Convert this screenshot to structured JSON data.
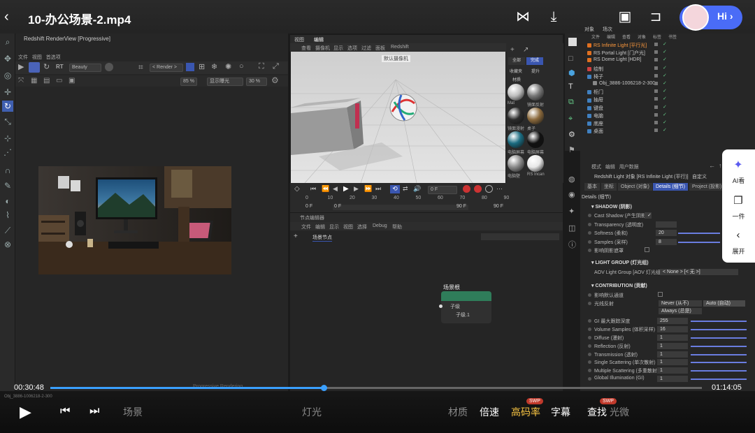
{
  "video": {
    "title": "10-办公场景-2.mp4",
    "time_current": "00:30:48",
    "time_total": "01:14:05",
    "progress": 0.42
  },
  "user": {
    "greeting": "Hi"
  },
  "top_icons": [
    "share-icon",
    "download-icon",
    "screen-capture-icon",
    "exit-fullscreen-icon"
  ],
  "render_view": {
    "title": "Redshift RenderView [Progressive]",
    "menu": [
      "文件",
      "视图",
      "首选项"
    ],
    "aov_select": "Beauty",
    "camera_select": "< Render >",
    "zoom_a": "85 %",
    "zoom_b": "30 %",
    "display_select": "显示曝光"
  },
  "viewport": {
    "tabs": [
      "视图",
      "编辑"
    ],
    "menu": [
      "查看",
      "摄像机",
      "显示",
      "选项",
      "过滤",
      "面板",
      "Redshift"
    ],
    "camera_label": "默认摄像机"
  },
  "materials": {
    "tabs": [
      "全部",
      "完成"
    ],
    "filters": [
      "收藏夹",
      "提升"
    ],
    "title": "材质",
    "items": [
      {
        "name": "Mat",
        "color": "#bfbfbf"
      },
      {
        "name": "镜面反射",
        "color": "#777777"
      },
      {
        "name": "镜面漫射",
        "color": "#2b2b2b"
      },
      {
        "name": "桌子",
        "color": "#8b6a3d"
      },
      {
        "name": "电脑屏幕",
        "color": "#1a6b80"
      },
      {
        "name": "电脑屏幕",
        "color": "#111111"
      },
      {
        "name": "电脑壁",
        "color": "#8a8a8a"
      },
      {
        "name": "RS Incan",
        "color": "#e8e8e8"
      }
    ]
  },
  "timeline": {
    "frame_current": "0 F",
    "ticks": [
      "0",
      "10",
      "20",
      "30",
      "40",
      "50",
      "60",
      "70",
      "80",
      "90"
    ],
    "start": "0 F",
    "start2": "0 F",
    "end": "90 F",
    "end2": "90 F"
  },
  "node_editor": {
    "title": "节点编辑器",
    "menu": [
      "文件",
      "编辑",
      "显示",
      "视图",
      "选择",
      "资产",
      "Debug",
      "帮助"
    ],
    "breadcrumb": "场景节点",
    "node_title": "场景根",
    "port_a": "子级",
    "port_b": "子级.1",
    "status": "Progressive Rendering"
  },
  "objects": {
    "tabs": [
      "对象",
      "场次"
    ],
    "menu": [
      "文件",
      "编辑",
      "查看",
      "对象",
      "标签",
      "书签"
    ],
    "rows": [
      {
        "name": "RS Infinite Light [平行光]",
        "color": "#e07020",
        "highlight": true
      },
      {
        "name": "RS Portal Light [门户光]",
        "color": "#e07020"
      },
      {
        "name": "RS Dome Light [HDR]",
        "color": "#e07020"
      },
      {
        "name": "绘制",
        "color": "#d04040"
      },
      {
        "name": "椅子",
        "color": "#4080c0"
      },
      {
        "name": "Obj_3886-1006218-2-300",
        "color": "#888888"
      },
      {
        "name": "柜门",
        "color": "#4080c0"
      },
      {
        "name": "抽屉",
        "color": "#4080c0"
      },
      {
        "name": "键盘",
        "color": "#4080c0"
      },
      {
        "name": "电脑",
        "color": "#4080c0"
      },
      {
        "name": "底座",
        "color": "#4080c0"
      },
      {
        "name": "桌面",
        "color": "#4080c0"
      }
    ]
  },
  "attributes": {
    "header_menu": [
      "模式",
      "编辑",
      "用户数据"
    ],
    "object_line": "Redshift Light 对象 [RS Infinite Light (平行)]",
    "preset": "自定义",
    "tabs": [
      "基本",
      "坐标",
      "Object (对象)",
      "Details (细节)",
      "Project (投影)"
    ],
    "details_label": "Details (细节)",
    "shadow": {
      "title": "SHADOW (阴影)",
      "rows": [
        {
          "label": "Cast Shadow (产生阴影)",
          "value": "✓"
        },
        {
          "label": "Transparency (透明度)",
          "value": ""
        },
        {
          "label": "Softness (柔和)",
          "value": "20"
        },
        {
          "label": "Samples (采样)",
          "value": "8"
        },
        {
          "label": "影响阴影遮罩",
          "value": ""
        }
      ]
    },
    "light_group": {
      "title": "LIGHT GROUP (灯光组)",
      "label": "AOV Light Group [AOV 灯光组]",
      "value": "< None > [< 无 >]"
    },
    "contribution": {
      "title": "CONTRIBUTION (贡献)",
      "rows": [
        {
          "label": "影响默认通道",
          "value": ""
        },
        {
          "label": "光线反射",
          "value": "Never (从不)",
          "value2": "Auto (自动)"
        },
        {
          "label": "",
          "value": "Always (总是)"
        },
        {
          "label": "GI 最大跟踪深度",
          "value": "255"
        },
        {
          "label": "Volume Samples (体积采样)",
          "value": "16"
        },
        {
          "label": "Diffuse (漫射)",
          "value": "1"
        },
        {
          "label": "Reflection (反射)",
          "value": "1"
        },
        {
          "label": "Transmission (透射)",
          "value": "1"
        },
        {
          "label": "Single Scattering (单次散射)",
          "value": "1"
        },
        {
          "label": "Multiple Scattering (多重散射)",
          "value": "1"
        },
        {
          "label": "Global Illumination (GI)",
          "value": "1"
        }
      ]
    }
  },
  "float_panel": {
    "ai_label": "AI看",
    "copy_label": "一件",
    "expand_label": "展开"
  },
  "player": {
    "chapter_1": "场景",
    "chapter_2": "灯光",
    "chapter_3": "材质",
    "speed": "倍速",
    "quality": "高码率",
    "subtitle": "字幕",
    "search": "查找",
    "extra": "光微",
    "swp": "SWP",
    "status_line": "Obj_3886-1006218-2-300"
  }
}
